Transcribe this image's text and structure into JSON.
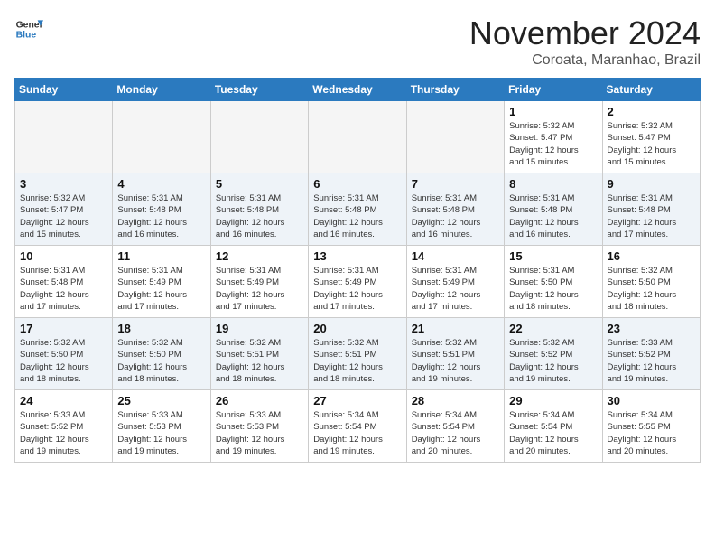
{
  "header": {
    "logo_line1": "General",
    "logo_line2": "Blue",
    "month": "November 2024",
    "location": "Coroata, Maranhao, Brazil"
  },
  "weekdays": [
    "Sunday",
    "Monday",
    "Tuesday",
    "Wednesday",
    "Thursday",
    "Friday",
    "Saturday"
  ],
  "weeks": [
    [
      {
        "day": "",
        "info": ""
      },
      {
        "day": "",
        "info": ""
      },
      {
        "day": "",
        "info": ""
      },
      {
        "day": "",
        "info": ""
      },
      {
        "day": "",
        "info": ""
      },
      {
        "day": "1",
        "info": "Sunrise: 5:32 AM\nSunset: 5:47 PM\nDaylight: 12 hours\nand 15 minutes."
      },
      {
        "day": "2",
        "info": "Sunrise: 5:32 AM\nSunset: 5:47 PM\nDaylight: 12 hours\nand 15 minutes."
      }
    ],
    [
      {
        "day": "3",
        "info": "Sunrise: 5:32 AM\nSunset: 5:47 PM\nDaylight: 12 hours\nand 15 minutes."
      },
      {
        "day": "4",
        "info": "Sunrise: 5:31 AM\nSunset: 5:48 PM\nDaylight: 12 hours\nand 16 minutes."
      },
      {
        "day": "5",
        "info": "Sunrise: 5:31 AM\nSunset: 5:48 PM\nDaylight: 12 hours\nand 16 minutes."
      },
      {
        "day": "6",
        "info": "Sunrise: 5:31 AM\nSunset: 5:48 PM\nDaylight: 12 hours\nand 16 minutes."
      },
      {
        "day": "7",
        "info": "Sunrise: 5:31 AM\nSunset: 5:48 PM\nDaylight: 12 hours\nand 16 minutes."
      },
      {
        "day": "8",
        "info": "Sunrise: 5:31 AM\nSunset: 5:48 PM\nDaylight: 12 hours\nand 16 minutes."
      },
      {
        "day": "9",
        "info": "Sunrise: 5:31 AM\nSunset: 5:48 PM\nDaylight: 12 hours\nand 17 minutes."
      }
    ],
    [
      {
        "day": "10",
        "info": "Sunrise: 5:31 AM\nSunset: 5:48 PM\nDaylight: 12 hours\nand 17 minutes."
      },
      {
        "day": "11",
        "info": "Sunrise: 5:31 AM\nSunset: 5:49 PM\nDaylight: 12 hours\nand 17 minutes."
      },
      {
        "day": "12",
        "info": "Sunrise: 5:31 AM\nSunset: 5:49 PM\nDaylight: 12 hours\nand 17 minutes."
      },
      {
        "day": "13",
        "info": "Sunrise: 5:31 AM\nSunset: 5:49 PM\nDaylight: 12 hours\nand 17 minutes."
      },
      {
        "day": "14",
        "info": "Sunrise: 5:31 AM\nSunset: 5:49 PM\nDaylight: 12 hours\nand 17 minutes."
      },
      {
        "day": "15",
        "info": "Sunrise: 5:31 AM\nSunset: 5:50 PM\nDaylight: 12 hours\nand 18 minutes."
      },
      {
        "day": "16",
        "info": "Sunrise: 5:32 AM\nSunset: 5:50 PM\nDaylight: 12 hours\nand 18 minutes."
      }
    ],
    [
      {
        "day": "17",
        "info": "Sunrise: 5:32 AM\nSunset: 5:50 PM\nDaylight: 12 hours\nand 18 minutes."
      },
      {
        "day": "18",
        "info": "Sunrise: 5:32 AM\nSunset: 5:50 PM\nDaylight: 12 hours\nand 18 minutes."
      },
      {
        "day": "19",
        "info": "Sunrise: 5:32 AM\nSunset: 5:51 PM\nDaylight: 12 hours\nand 18 minutes."
      },
      {
        "day": "20",
        "info": "Sunrise: 5:32 AM\nSunset: 5:51 PM\nDaylight: 12 hours\nand 18 minutes."
      },
      {
        "day": "21",
        "info": "Sunrise: 5:32 AM\nSunset: 5:51 PM\nDaylight: 12 hours\nand 19 minutes."
      },
      {
        "day": "22",
        "info": "Sunrise: 5:32 AM\nSunset: 5:52 PM\nDaylight: 12 hours\nand 19 minutes."
      },
      {
        "day": "23",
        "info": "Sunrise: 5:33 AM\nSunset: 5:52 PM\nDaylight: 12 hours\nand 19 minutes."
      }
    ],
    [
      {
        "day": "24",
        "info": "Sunrise: 5:33 AM\nSunset: 5:52 PM\nDaylight: 12 hours\nand 19 minutes."
      },
      {
        "day": "25",
        "info": "Sunrise: 5:33 AM\nSunset: 5:53 PM\nDaylight: 12 hours\nand 19 minutes."
      },
      {
        "day": "26",
        "info": "Sunrise: 5:33 AM\nSunset: 5:53 PM\nDaylight: 12 hours\nand 19 minutes."
      },
      {
        "day": "27",
        "info": "Sunrise: 5:34 AM\nSunset: 5:54 PM\nDaylight: 12 hours\nand 19 minutes."
      },
      {
        "day": "28",
        "info": "Sunrise: 5:34 AM\nSunset: 5:54 PM\nDaylight: 12 hours\nand 20 minutes."
      },
      {
        "day": "29",
        "info": "Sunrise: 5:34 AM\nSunset: 5:54 PM\nDaylight: 12 hours\nand 20 minutes."
      },
      {
        "day": "30",
        "info": "Sunrise: 5:34 AM\nSunset: 5:55 PM\nDaylight: 12 hours\nand 20 minutes."
      }
    ]
  ]
}
